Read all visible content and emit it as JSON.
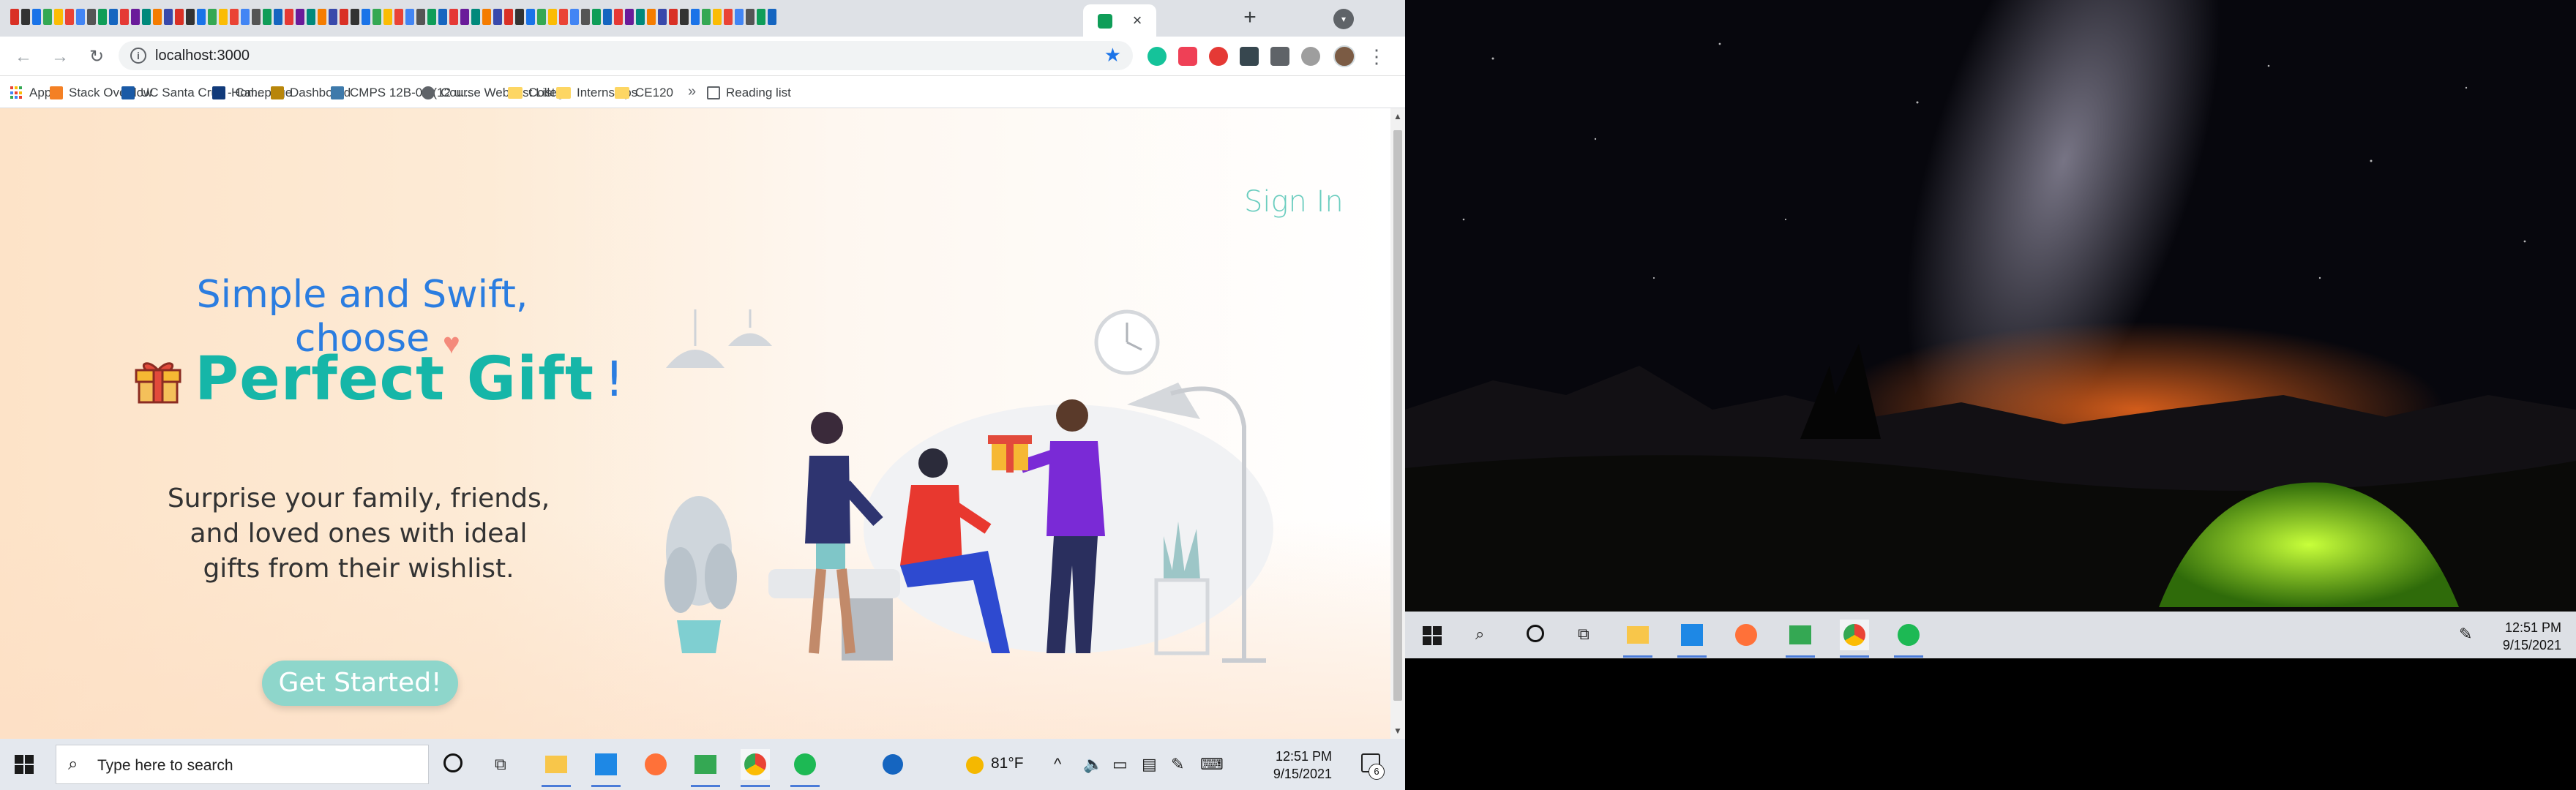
{
  "browser": {
    "url": "localhost:3000",
    "bookmarks": [
      {
        "label": "Apps",
        "icon": "apps-grid-icon"
      },
      {
        "label": "Stack Overflow",
        "icon": "stackoverflow-icon"
      },
      {
        "label": "UC Santa Cruz - Cal...",
        "icon": "ucsc-calendar-icon"
      },
      {
        "label": "Homepage",
        "icon": "homepage-icon"
      },
      {
        "label": "Dashboard",
        "icon": "dashboard-icon"
      },
      {
        "label": "CMPS 12B-01 (12 u...",
        "icon": "piazza-icon"
      },
      {
        "label": "Course Webcast List",
        "icon": "globe-icon"
      },
      {
        "label": "College",
        "icon": "folder-icon"
      },
      {
        "label": "Internships",
        "icon": "folder-icon"
      },
      {
        "label": "CE120",
        "icon": "folder-icon"
      }
    ],
    "reading_list": "Reading list"
  },
  "page": {
    "sign_in": "Sign In",
    "tagline": "Simple and Swift, choose",
    "title": "Perfect Gift",
    "title_suffix": "!",
    "description": "Surprise your family, friends, and loved ones with ideal gifts from their wishlist.",
    "cta": "Get Started!"
  },
  "taskbar_left": {
    "search_placeholder": "Type here to search",
    "weather": "81°F",
    "time": "12:51 PM",
    "date": "9/15/2021",
    "notification_count": "6"
  },
  "taskbar_right": {
    "time": "12:51 PM",
    "date": "9/15/2021"
  },
  "colors": {
    "accent_teal": "#16b6a8",
    "accent_blue": "#2b7de0",
    "button_teal": "#8ed6cb"
  }
}
